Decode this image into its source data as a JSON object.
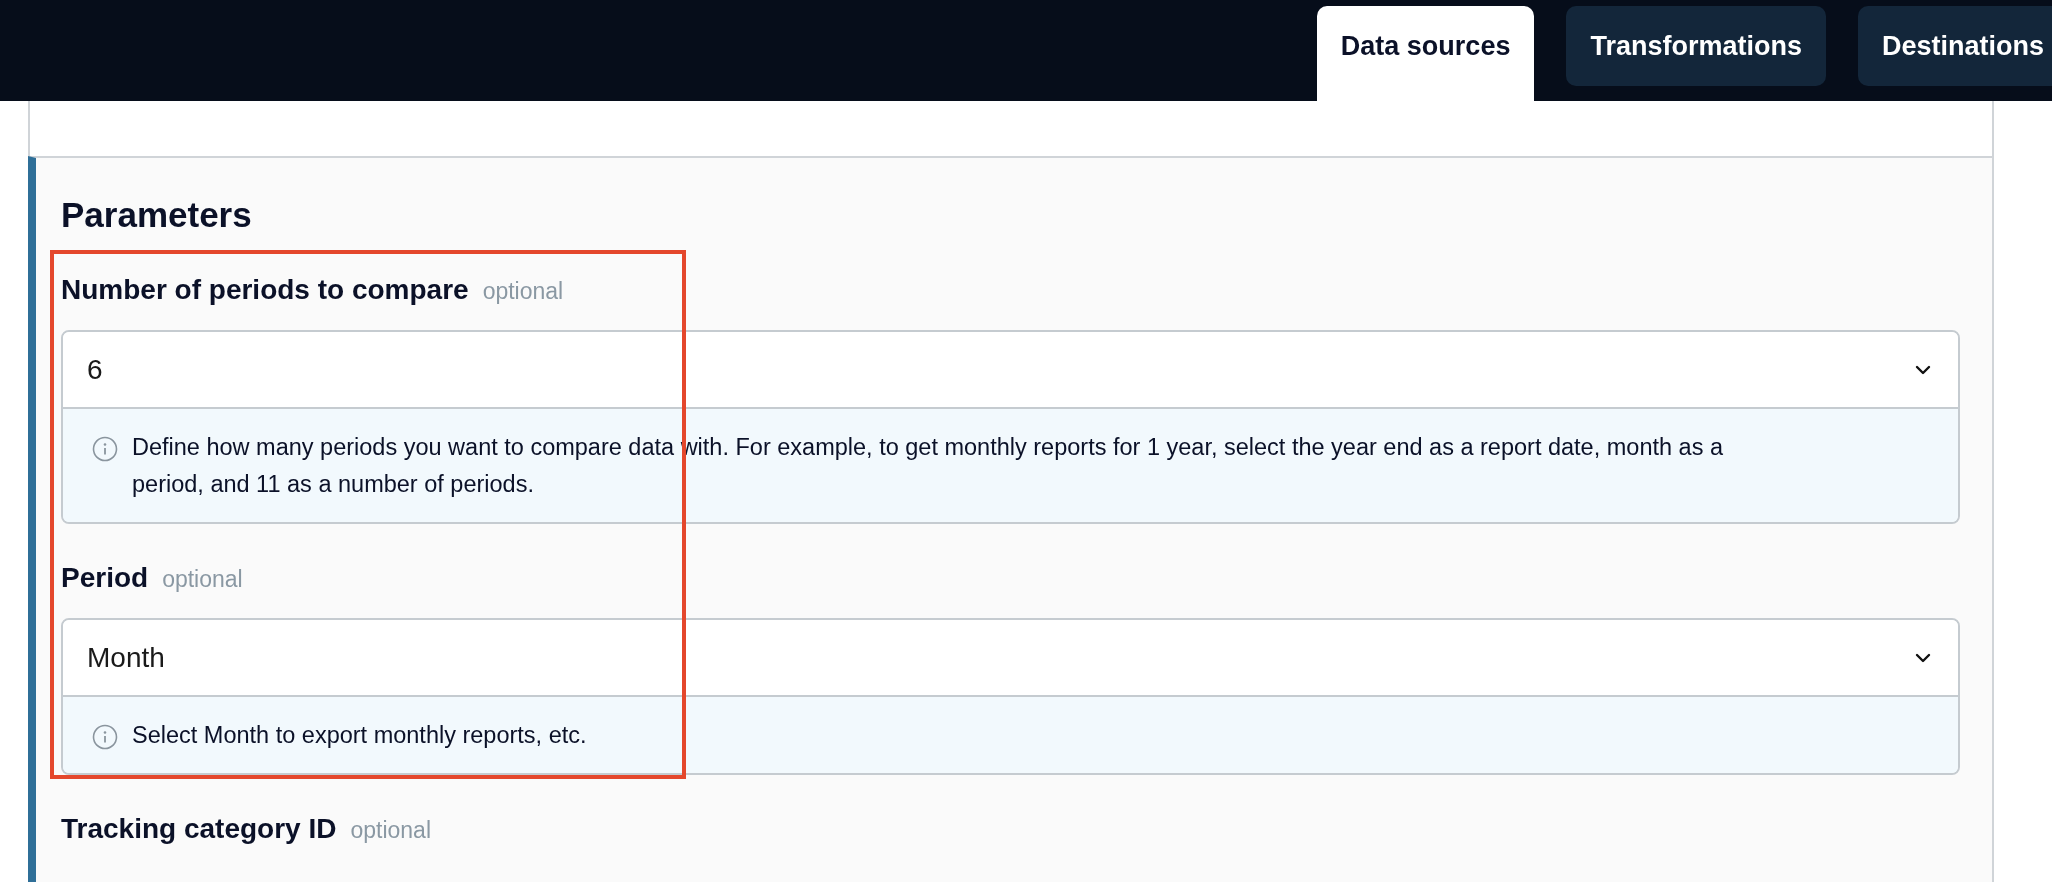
{
  "tabs": [
    {
      "label": "Data sources",
      "selected": true
    },
    {
      "label": "Transformations",
      "selected": false
    },
    {
      "label": "Destinations",
      "selected": false
    }
  ],
  "section": {
    "title": "Parameters"
  },
  "fields": [
    {
      "label": "Number of periods to compare",
      "tag": "optional",
      "value": "6",
      "help": "Define how many periods you want to compare data with. For example, to get monthly reports for 1 year, select the year end as a report date, month as a period, and 11 as a number of periods.",
      "highlighted": true
    },
    {
      "label": "Period",
      "tag": "optional",
      "value": "Month",
      "help": "Select Month to export monthly reports, etc.",
      "highlighted": true
    },
    {
      "label": "Tracking category ID",
      "tag": "optional"
    }
  ]
}
